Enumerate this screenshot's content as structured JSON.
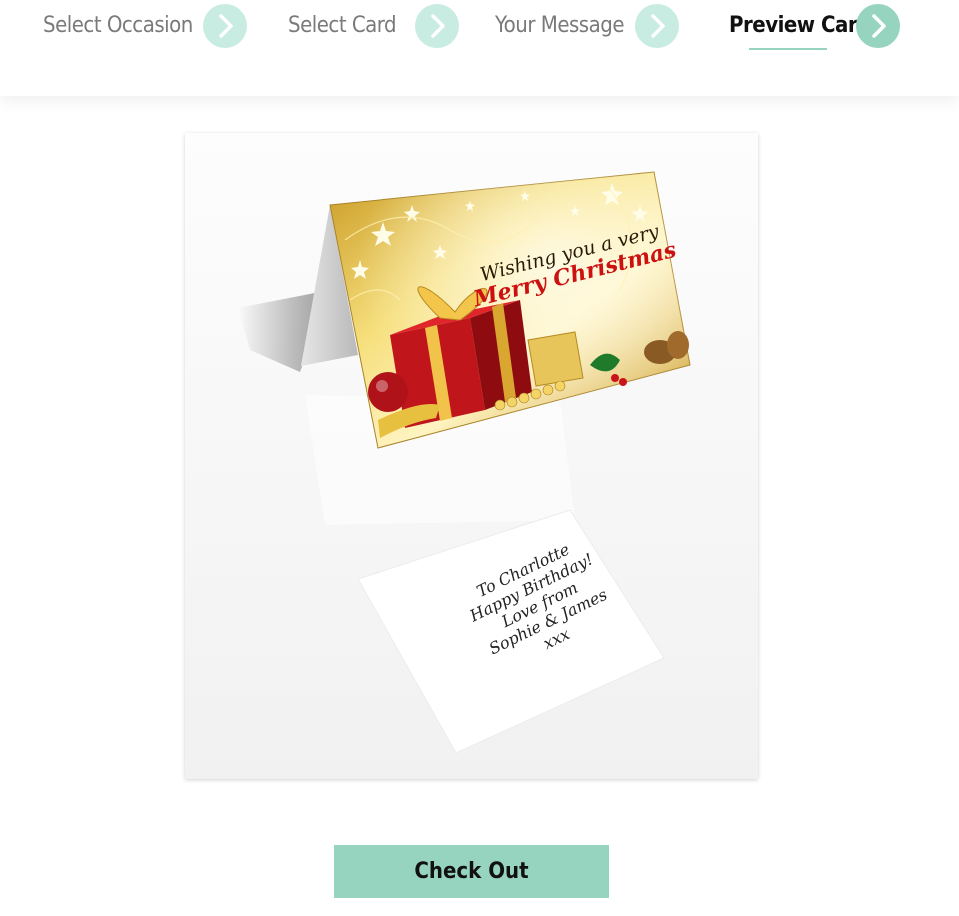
{
  "steps": [
    {
      "label": "Select Occasion",
      "icon": "chevron-right-icon",
      "active": false
    },
    {
      "label": "Select Card",
      "icon": "chevron-right-icon",
      "active": false
    },
    {
      "label": "Your Message",
      "icon": "chevron-right-icon",
      "active": false
    },
    {
      "label": "Preview Card",
      "icon": "chevron-right-icon",
      "active": true
    }
  ],
  "card": {
    "front_line1": "Wishing you a very",
    "front_line2": "Merry Christmas",
    "inside_message": [
      "To Charlotte",
      "Happy Birthday!",
      "Love from",
      "Sophie & James",
      "xxx"
    ]
  },
  "checkout_label": "Check Out",
  "colors": {
    "accent": "#97d4bf",
    "accent_light": "#c8ece2",
    "gold": "#e2b43a",
    "text_red": "#cc1111"
  }
}
